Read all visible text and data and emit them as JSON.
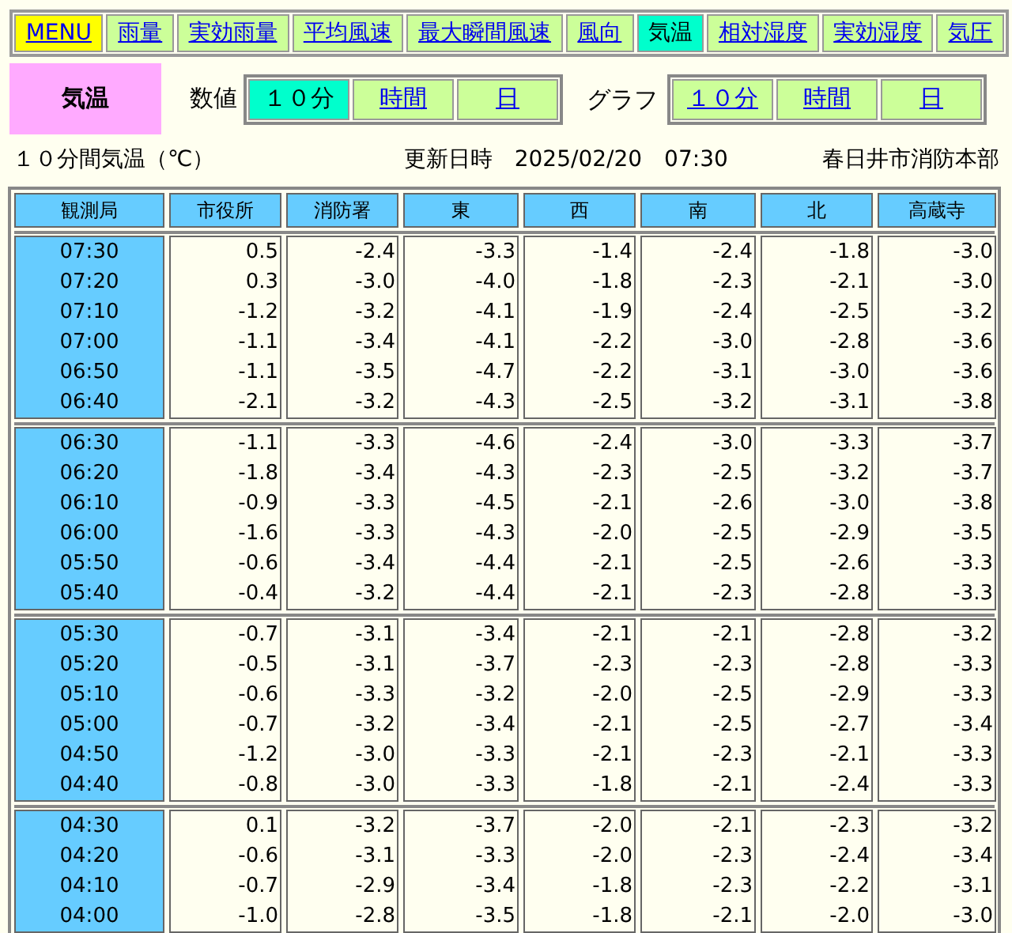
{
  "nav": [
    {
      "label": "MENU",
      "kind": "menu",
      "selected": false
    },
    {
      "label": "雨量",
      "kind": "item",
      "selected": false
    },
    {
      "label": "実効雨量",
      "kind": "item",
      "selected": false
    },
    {
      "label": "平均風速",
      "kind": "item",
      "selected": false
    },
    {
      "label": "最大瞬間風速",
      "kind": "item",
      "selected": false
    },
    {
      "label": "風向",
      "kind": "item",
      "selected": false
    },
    {
      "label": "気温",
      "kind": "item",
      "selected": true
    },
    {
      "label": "相対湿度",
      "kind": "item",
      "selected": false
    },
    {
      "label": "実効湿度",
      "kind": "item",
      "selected": false
    },
    {
      "label": "気圧",
      "kind": "item",
      "selected": false
    }
  ],
  "page_title": "気温",
  "numeric": {
    "label": "数値",
    "options": [
      {
        "label": "１０分",
        "selected": true
      },
      {
        "label": "時間",
        "selected": false
      },
      {
        "label": "日",
        "selected": false
      }
    ]
  },
  "graph": {
    "label": "グラフ",
    "options": [
      {
        "label": "１０分",
        "selected": false
      },
      {
        "label": "時間",
        "selected": false
      },
      {
        "label": "日",
        "selected": false
      }
    ]
  },
  "info": {
    "title": "１０分間気温（℃）",
    "updated": "更新日時　2025/02/20　07:30",
    "source": "春日井市消防本部"
  },
  "columns": [
    "観測局",
    "市役所",
    "消防署",
    "東",
    "西",
    "南",
    "北",
    "高蔵寺"
  ],
  "blocks": [
    {
      "rows": [
        {
          "time": "07:30",
          "values": [
            "0.5",
            "-2.4",
            "-3.3",
            "-1.4",
            "-2.4",
            "-1.8",
            "-3.0"
          ]
        },
        {
          "time": "07:20",
          "values": [
            "0.3",
            "-3.0",
            "-4.0",
            "-1.8",
            "-2.3",
            "-2.1",
            "-3.0"
          ]
        },
        {
          "time": "07:10",
          "values": [
            "-1.2",
            "-3.2",
            "-4.1",
            "-1.9",
            "-2.4",
            "-2.5",
            "-3.2"
          ]
        },
        {
          "time": "07:00",
          "values": [
            "-1.1",
            "-3.4",
            "-4.1",
            "-2.2",
            "-3.0",
            "-2.8",
            "-3.6"
          ]
        },
        {
          "time": "06:50",
          "values": [
            "-1.1",
            "-3.5",
            "-4.7",
            "-2.2",
            "-3.1",
            "-3.0",
            "-3.6"
          ]
        },
        {
          "time": "06:40",
          "values": [
            "-2.1",
            "-3.2",
            "-4.3",
            "-2.5",
            "-3.2",
            "-3.1",
            "-3.8"
          ]
        }
      ]
    },
    {
      "rows": [
        {
          "time": "06:30",
          "values": [
            "-1.1",
            "-3.3",
            "-4.6",
            "-2.4",
            "-3.0",
            "-3.3",
            "-3.7"
          ]
        },
        {
          "time": "06:20",
          "values": [
            "-1.8",
            "-3.4",
            "-4.3",
            "-2.3",
            "-2.5",
            "-3.2",
            "-3.7"
          ]
        },
        {
          "time": "06:10",
          "values": [
            "-0.9",
            "-3.3",
            "-4.5",
            "-2.1",
            "-2.6",
            "-3.0",
            "-3.8"
          ]
        },
        {
          "time": "06:00",
          "values": [
            "-1.6",
            "-3.3",
            "-4.3",
            "-2.0",
            "-2.5",
            "-2.9",
            "-3.5"
          ]
        },
        {
          "time": "05:50",
          "values": [
            "-0.6",
            "-3.4",
            "-4.4",
            "-2.1",
            "-2.5",
            "-2.6",
            "-3.3"
          ]
        },
        {
          "time": "05:40",
          "values": [
            "-0.4",
            "-3.2",
            "-4.4",
            "-2.1",
            "-2.3",
            "-2.8",
            "-3.3"
          ]
        }
      ]
    },
    {
      "rows": [
        {
          "time": "05:30",
          "values": [
            "-0.7",
            "-3.1",
            "-3.4",
            "-2.1",
            "-2.1",
            "-2.8",
            "-3.2"
          ]
        },
        {
          "time": "05:20",
          "values": [
            "-0.5",
            "-3.1",
            "-3.7",
            "-2.3",
            "-2.3",
            "-2.8",
            "-3.3"
          ]
        },
        {
          "time": "05:10",
          "values": [
            "-0.6",
            "-3.3",
            "-3.2",
            "-2.0",
            "-2.5",
            "-2.9",
            "-3.3"
          ]
        },
        {
          "time": "05:00",
          "values": [
            "-0.7",
            "-3.2",
            "-3.4",
            "-2.1",
            "-2.5",
            "-2.7",
            "-3.4"
          ]
        },
        {
          "time": "04:50",
          "values": [
            "-1.2",
            "-3.0",
            "-3.3",
            "-2.1",
            "-2.3",
            "-2.1",
            "-3.3"
          ]
        },
        {
          "time": "04:40",
          "values": [
            "-0.8",
            "-3.0",
            "-3.3",
            "-1.8",
            "-2.1",
            "-2.4",
            "-3.3"
          ]
        }
      ]
    },
    {
      "rows": [
        {
          "time": "04:30",
          "values": [
            "0.1",
            "-3.2",
            "-3.7",
            "-2.0",
            "-2.1",
            "-2.3",
            "-3.2"
          ]
        },
        {
          "time": "04:20",
          "values": [
            "-0.6",
            "-3.1",
            "-3.3",
            "-2.0",
            "-2.3",
            "-2.4",
            "-3.4"
          ]
        },
        {
          "time": "04:10",
          "values": [
            "-0.7",
            "-2.9",
            "-3.4",
            "-1.8",
            "-2.3",
            "-2.2",
            "-3.1"
          ]
        },
        {
          "time": "04:00",
          "values": [
            "-1.0",
            "-2.8",
            "-3.5",
            "-1.8",
            "-2.1",
            "-2.0",
            "-3.0"
          ]
        }
      ]
    }
  ]
}
